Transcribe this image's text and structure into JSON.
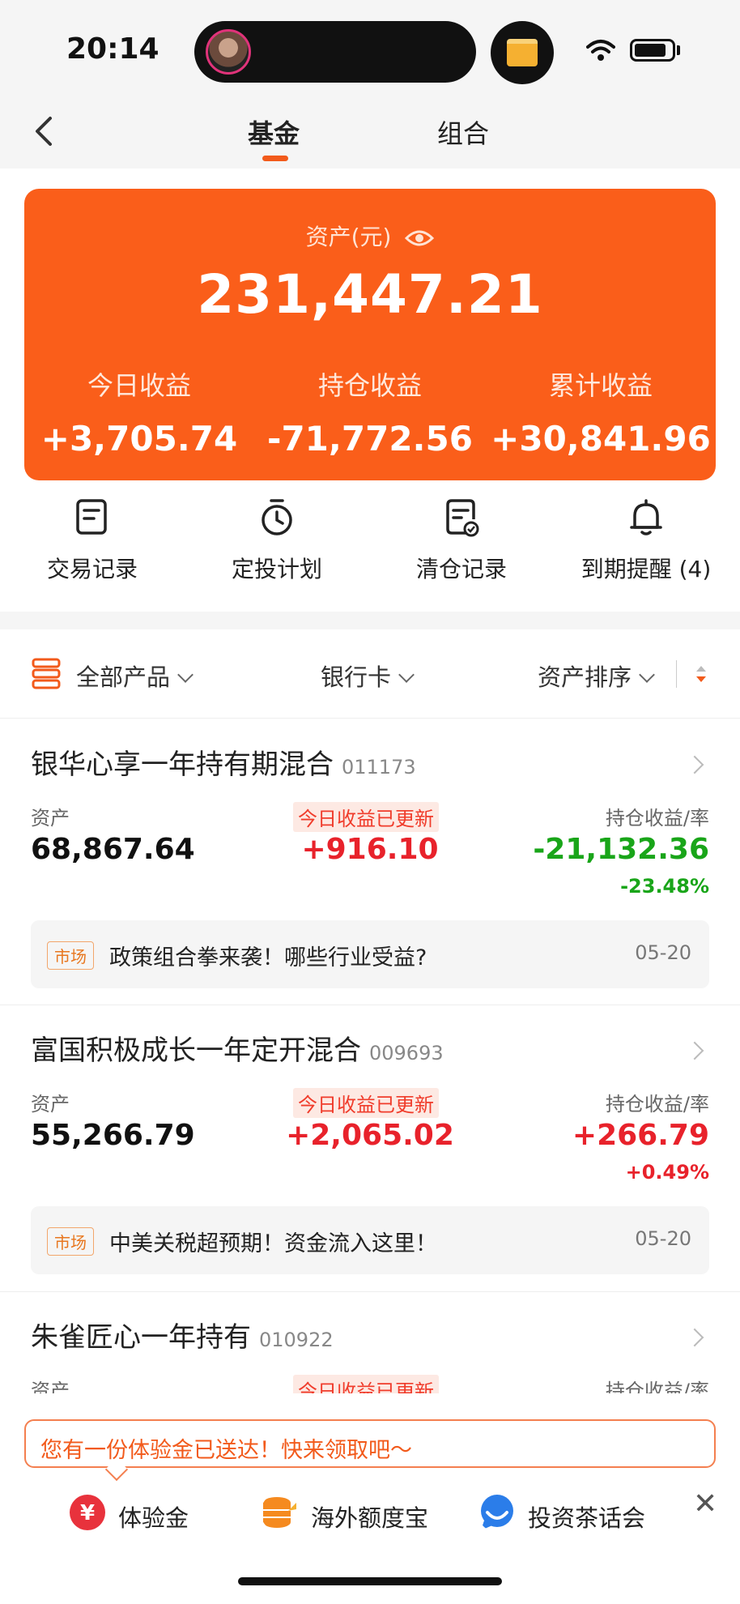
{
  "status": {
    "time": "20:14"
  },
  "header": {
    "tabs": [
      "基金",
      "组合"
    ]
  },
  "asset_card": {
    "title": "资产(元)",
    "total": "231,447.21",
    "stats": [
      {
        "label": "今日收益",
        "value": "+3,705.74"
      },
      {
        "label": "持仓收益",
        "value": "-71,772.56"
      },
      {
        "label": "累计收益",
        "value": "+30,841.96"
      }
    ]
  },
  "actions": [
    {
      "label": "交易记录",
      "icon": "document-icon"
    },
    {
      "label": "定投计划",
      "icon": "timer-icon"
    },
    {
      "label": "清仓记录",
      "icon": "cleared-record-icon"
    },
    {
      "label": "到期提醒 (4)",
      "icon": "bell-icon"
    }
  ],
  "filters": {
    "all": "全部产品",
    "bank": "银行卡",
    "sort": "资产排序"
  },
  "funds": [
    {
      "name": "银华心享一年持有期混合",
      "code": "011173",
      "asset_label": "资产",
      "updated_label": "今日收益已更新",
      "hold_label": "持仓收益/率",
      "asset": "68,867.64",
      "today": "+916.10",
      "hold": "-21,132.36",
      "rate": "-23.48%",
      "news_tag": "市场",
      "news": "政策组合拳来袭！哪些行业受益?",
      "news_date": "05-20"
    },
    {
      "name": "富国积极成长一年定开混合",
      "code": "009693",
      "asset_label": "资产",
      "updated_label": "今日收益已更新",
      "hold_label": "持仓收益/率",
      "asset": "55,266.79",
      "today": "+2,065.02",
      "hold": "+266.79",
      "rate": "+0.49%",
      "news_tag": "市场",
      "news": "中美关税超预期！资金流入这里！",
      "news_date": "05-20"
    },
    {
      "name": "朱雀匠心一年持有",
      "code": "010922",
      "asset_label": "资产",
      "updated_label": "今日收益已更新",
      "hold_label": "持仓收益/率"
    }
  ],
  "tooltip": "您有一份体验金已送达！快来领取吧～",
  "promos": [
    {
      "label": "体验金",
      "icon": "yen-icon",
      "color": "#e8323c"
    },
    {
      "label": "海外额度宝",
      "icon": "coin-stack-icon",
      "color": "#f58a1f"
    },
    {
      "label": "投资茶话会",
      "icon": "chat-bubble-icon",
      "color": "#2b7de9"
    }
  ],
  "colors": {
    "accent": "#fa5e1a",
    "gain": "#e8222b",
    "loss": "#19a519"
  }
}
